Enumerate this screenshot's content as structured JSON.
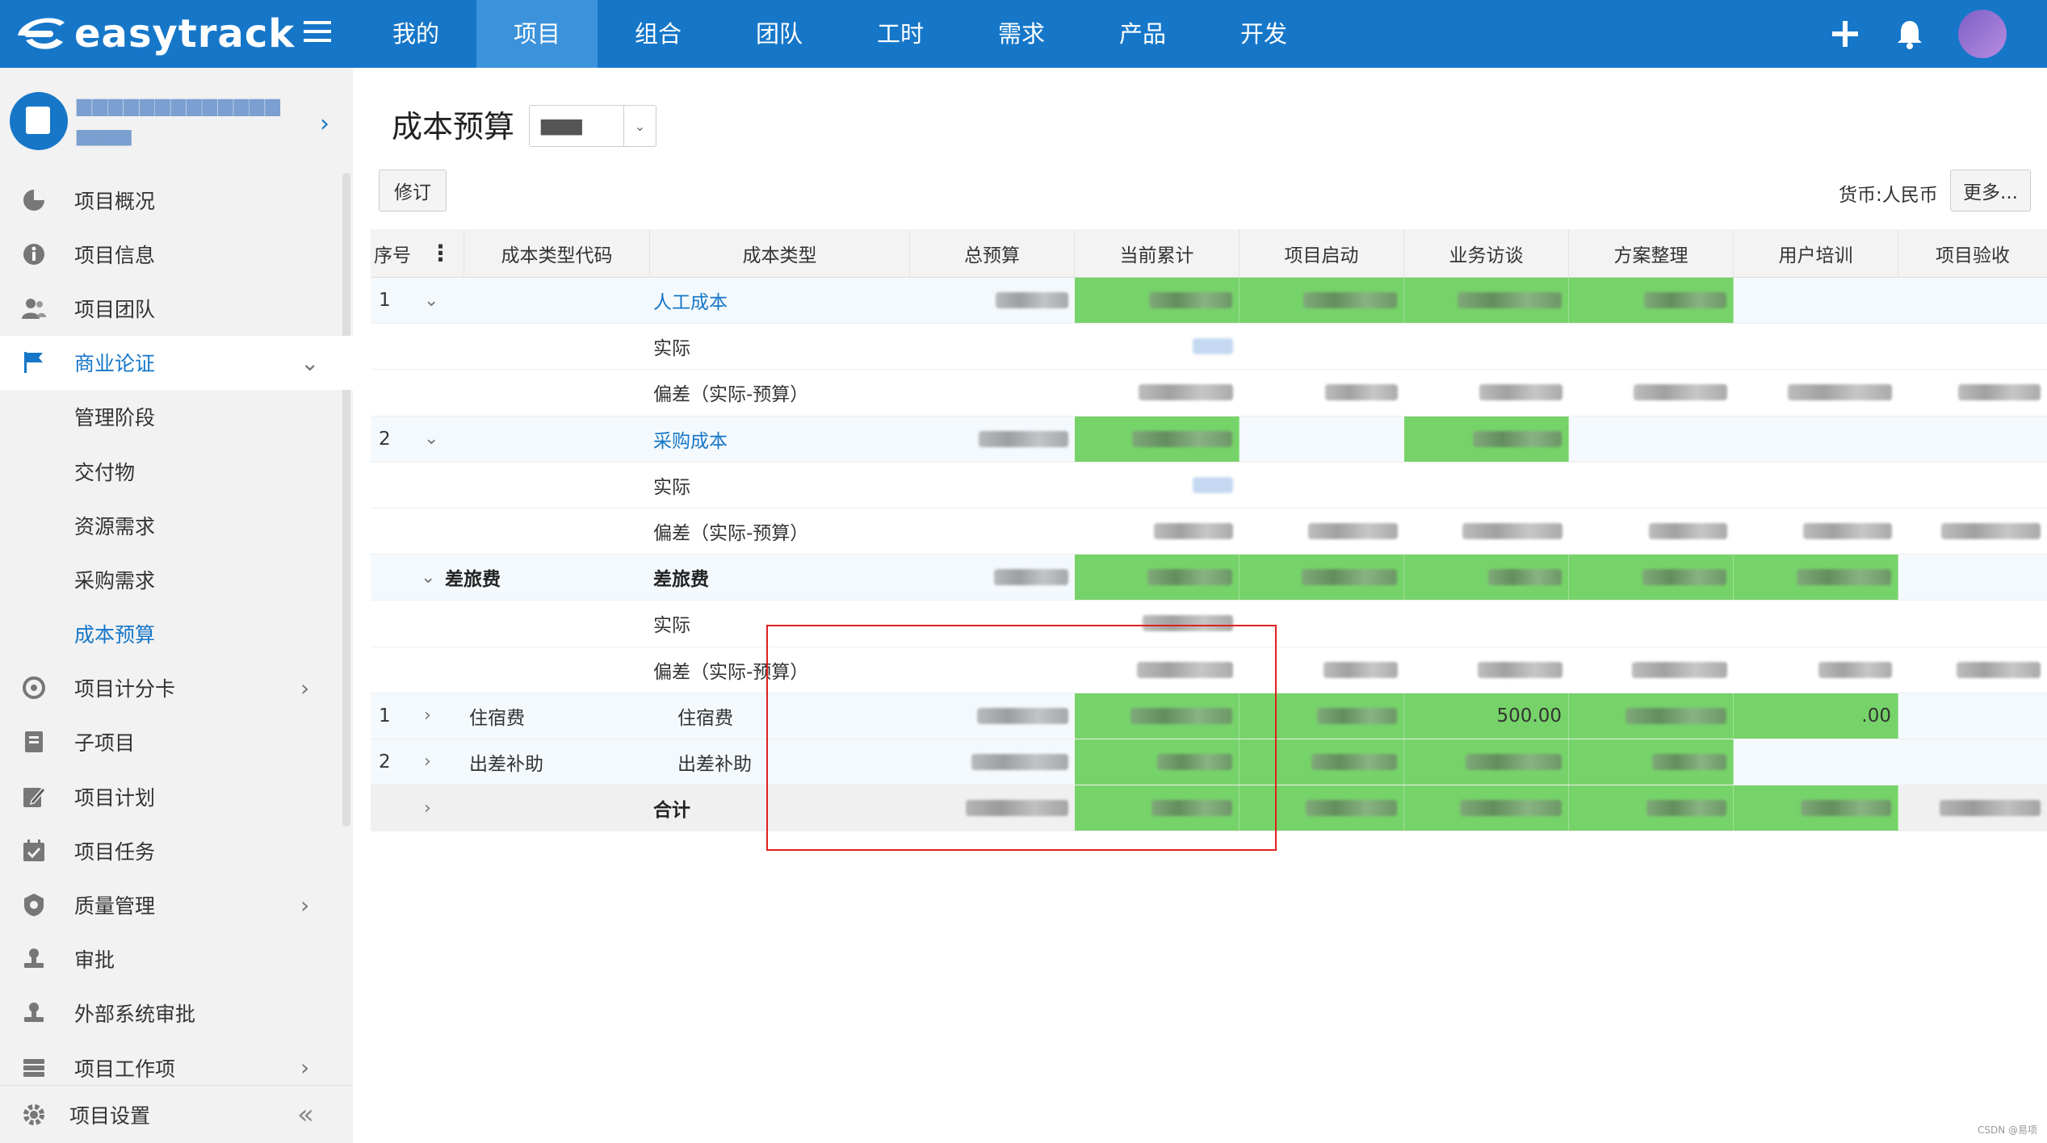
{
  "app": {
    "name": "easytrack"
  },
  "topnav": {
    "items": [
      "我的",
      "项目",
      "组合",
      "团队",
      "工时",
      "需求",
      "产品",
      "开发"
    ],
    "active": "项目"
  },
  "colors": {
    "primary": "#1677c9",
    "highlight": "#76d369",
    "annotation": "#e02020"
  },
  "project": {
    "name": "▆▆▆▆▆▆▆▆▆▆▆▆▆",
    "code": "▆▆▆▆"
  },
  "sidebar": {
    "items": [
      {
        "label": "项目概况",
        "icon": "pie-chart-icon"
      },
      {
        "label": "项目信息",
        "icon": "info-icon"
      },
      {
        "label": "项目团队",
        "icon": "team-icon"
      },
      {
        "label": "商业论证",
        "icon": "flag-icon"
      },
      {
        "label": "管理阶段"
      },
      {
        "label": "交付物"
      },
      {
        "label": "资源需求"
      },
      {
        "label": "采购需求"
      },
      {
        "label": "成本预算"
      },
      {
        "label": "项目计分卡",
        "icon": "target-icon"
      },
      {
        "label": "子项目",
        "icon": "document-icon"
      },
      {
        "label": "项目计划",
        "icon": "edit-icon"
      },
      {
        "label": "项目任务",
        "icon": "calendar-check-icon"
      },
      {
        "label": "质量管理",
        "icon": "shield-icon"
      },
      {
        "label": "审批",
        "icon": "stamp-icon"
      },
      {
        "label": "外部系统审批",
        "icon": "stamp-icon"
      },
      {
        "label": "项目工作项",
        "icon": "list-icon"
      }
    ],
    "settings_label": "项目设置"
  },
  "page": {
    "title": "成本预算",
    "version_value": "▆▆▆",
    "revise_label": "修订",
    "currency": "货币:人民币",
    "more_label": "更多..."
  },
  "table": {
    "headers": [
      "序号",
      "成本类型代码",
      "成本类型",
      "总预算",
      "当前累计",
      "项目启动",
      "业务访谈",
      "方案整理",
      "用户培训",
      "项目验收"
    ],
    "rows": [
      {
        "seq": "1",
        "code": "",
        "type": "人工成本"
      },
      {
        "seq": "",
        "code": "",
        "type": "实际"
      },
      {
        "seq": "",
        "code": "",
        "type": "偏差（实际-预算）"
      },
      {
        "seq": "2",
        "code": "",
        "type": "采购成本"
      },
      {
        "seq": "",
        "code": "",
        "type": "实际"
      },
      {
        "seq": "",
        "code": "",
        "type": "偏差（实际-预算）"
      },
      {
        "seq": "",
        "code": "差旅费",
        "type": "差旅费"
      },
      {
        "seq": "",
        "code": "",
        "type": "实际"
      },
      {
        "seq": "",
        "code": "",
        "type": "偏差（实际-预算）"
      },
      {
        "seq": "1",
        "code": "住宿费",
        "type": "住宿费",
        "partial": [
          "",
          "",
          "",
          "500.00",
          "",
          ".00"
        ]
      },
      {
        "seq": "2",
        "code": "出差补助",
        "type": "出差补助"
      },
      {
        "seq": "",
        "code": "",
        "type": "合计"
      }
    ]
  },
  "watermark": "CSDN @易项"
}
